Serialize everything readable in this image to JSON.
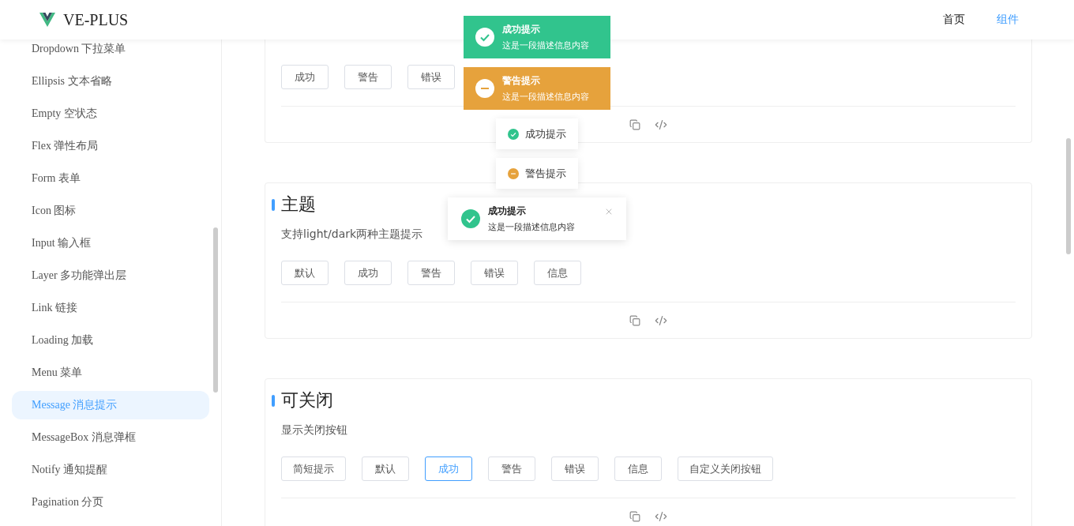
{
  "header": {
    "logo_text": "VE-PLUS",
    "nav": [
      {
        "label": "首页",
        "selected": false
      },
      {
        "label": "组件",
        "selected": true
      }
    ]
  },
  "sidebar": {
    "items": [
      {
        "label": "Dropdown 下拉菜单",
        "selected": false
      },
      {
        "label": "Ellipsis 文本省略",
        "selected": false
      },
      {
        "label": "Empty 空状态",
        "selected": false
      },
      {
        "label": "Flex 弹性布局",
        "selected": false
      },
      {
        "label": "Form 表单",
        "selected": false
      },
      {
        "label": "Icon 图标",
        "selected": false
      },
      {
        "label": "Input 输入框",
        "selected": false
      },
      {
        "label": "Layer 多功能弹出层",
        "selected": false
      },
      {
        "label": "Link 链接",
        "selected": false
      },
      {
        "label": "Loading 加载",
        "selected": false
      },
      {
        "label": "Menu 菜单",
        "selected": false
      },
      {
        "label": "Message 消息提示",
        "selected": true
      },
      {
        "label": "MessageBox 消息弹框",
        "selected": false
      },
      {
        "label": "Notify 通知提醒",
        "selected": false
      },
      {
        "label": "Pagination 分页",
        "selected": false
      }
    ]
  },
  "sections": [
    {
      "buttons": [
        {
          "label": "成功",
          "selected": false
        },
        {
          "label": "警告",
          "selected": false
        },
        {
          "label": "错误",
          "selected": false
        }
      ]
    },
    {
      "title": "主题",
      "description": "支持light/dark两种主题提示",
      "buttons": [
        {
          "label": "默认",
          "selected": false
        },
        {
          "label": "成功",
          "selected": false
        },
        {
          "label": "警告",
          "selected": false
        },
        {
          "label": "错误",
          "selected": false
        },
        {
          "label": "信息",
          "selected": false
        }
      ]
    },
    {
      "title": "可关闭",
      "description": "显示关闭按钮",
      "buttons": [
        {
          "label": "简短提示",
          "selected": false
        },
        {
          "label": "默认",
          "selected": false
        },
        {
          "label": "成功",
          "selected": true
        },
        {
          "label": "警告",
          "selected": false
        },
        {
          "label": "错误",
          "selected": false
        },
        {
          "label": "信息",
          "selected": false
        },
        {
          "label": "自定义关闭按钮",
          "selected": false
        }
      ]
    }
  ],
  "toasts": [
    {
      "kind": "filled",
      "color": "#31c48d",
      "title": "成功提示",
      "message": "这是一段描述信息内容"
    },
    {
      "kind": "filled",
      "color": "#e6a23c",
      "title": "警告提示",
      "message": "这是一段描述信息内容"
    },
    {
      "kind": "plain",
      "color": "#31c48d",
      "title": "成功提示"
    },
    {
      "kind": "plain",
      "color": "#e6a23c",
      "title": "警告提示"
    },
    {
      "kind": "closable",
      "color": "#31c48d",
      "title": "成功提示",
      "message": "这是一段描述信息内容"
    }
  ]
}
